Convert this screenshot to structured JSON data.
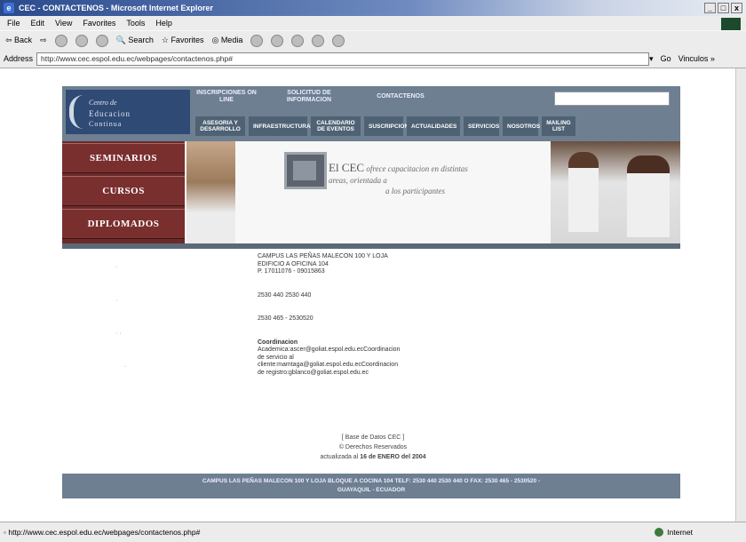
{
  "window": {
    "title": "CEC - CONTACTENOS - Microsoft Internet Explorer",
    "controls": [
      "_",
      "□",
      "x"
    ]
  },
  "menu": [
    "File",
    "Edit",
    "View",
    "Favorites",
    "Tools",
    "Help"
  ],
  "toolbar": {
    "back": "Back",
    "search": "Search",
    "favorites": "Favorites",
    "media": "Media"
  },
  "address": {
    "label": "Address",
    "url": "http://www.cec.espol.edu.ec/webpages/contactenos.php#",
    "go": "Go",
    "links": "Vinculos »"
  },
  "site": {
    "logo": {
      "line1": "Centro de",
      "line2": "Educacion",
      "line3": "Continua"
    },
    "topnav": [
      "INSCRIPCIONES ON LINE",
      "SOLICITUD DE INFORMACION",
      "CONTACTENOS"
    ],
    "subnav": [
      "ASESORIA Y DESARROLLO",
      "INFRAESTRUCTURA",
      "CALENDARIO DE EVENTOS",
      "SUSCRIPCION",
      "ACTUALIDADES",
      "SERVICIOS",
      "NOSOTROS",
      "MAILING LIST"
    ],
    "leftmenu": [
      "SEMINARIOS",
      "CURSOS",
      "DIPLOMADOS"
    ],
    "banner": {
      "heading": "El CEC",
      "text1": "ofrece capacitacion en distintas",
      "text2": "areas, orientada a",
      "text3": "a los participantes"
    }
  },
  "contact": {
    "address": {
      "line1": "CAMPUS LAS PEÑAS MALECON 100 Y LOJA",
      "line2": "EDIFICIO A OFICINA 104",
      "line3": "P. 17011076 - 09015863"
    },
    "phones1": "2530 440 2530 440",
    "phones2": "2530 465 - 2530520",
    "emails": {
      "l1": "Coordinacion",
      "l2": "Academica:ascer@goliat.espol.edu.ecCoordinacion",
      "l3": "de servicio al",
      "l4": "cliente:mamtaga@goliat.espol.edu.ecCoordinacion",
      "l5": "de registro:gblanco@goliat.espol.edu.ec"
    }
  },
  "footer": {
    "db": "[ Base de Datos CEC ]",
    "rights": "© Derechos Reservados",
    "updated_prefix": "actualizada al",
    "updated_date": "16 de ENERO del 2004"
  },
  "bottomband": {
    "line1": "CAMPUS LAS PEÑAS MALECON 100 Y LOJA BLOQUE A COCINA 104 TELF: 2530 440 2530 440 O FAX: 2530 465 - 2530520 -",
    "line2": "GUAYAQUIL - ECUADOR"
  },
  "status": {
    "url": "http://www.cec.espol.edu.ec/webpages/contactenos.php#",
    "zone": "Internet"
  }
}
